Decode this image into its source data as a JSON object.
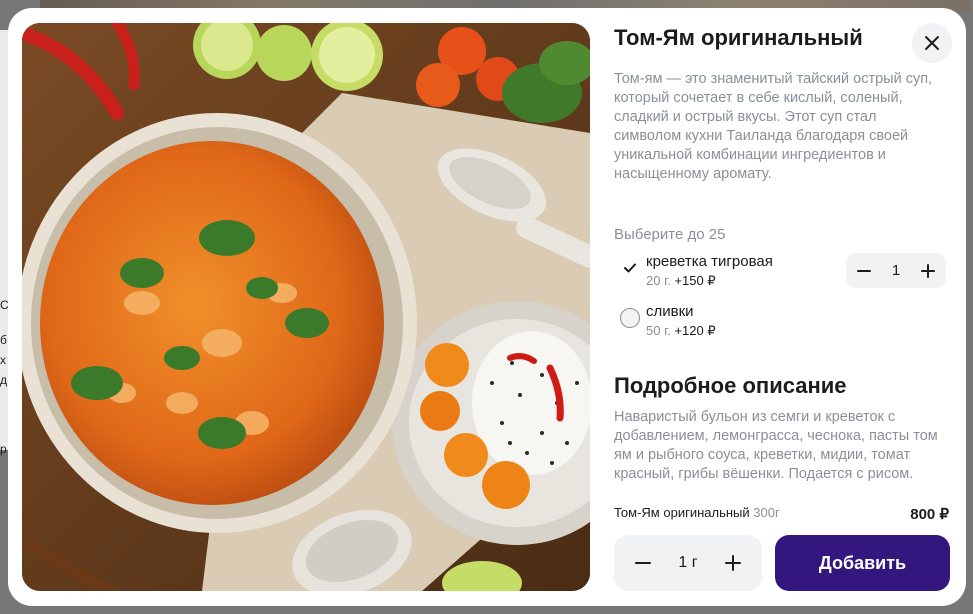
{
  "modal": {
    "title": "Том-Ям оригинальный",
    "close_icon": "close-icon",
    "description": "Том-ям — это знаменитый тайский острый суп, который сочетает в себе кислый, соленый, сладкий и острый вкусы. Этот суп стал символом кухни Таиланда благодаря своей уникальной комбинации ингредиентов и насыщенному аромату.",
    "choose_label": "Выберите до 25",
    "options": [
      {
        "name": "креветка тигровая",
        "weight": "20 г.",
        "price": "+150 ₽",
        "selected": true,
        "quantity": "1",
        "minus_icon": "minus-icon",
        "plus_icon": "plus-icon",
        "check_icon": "check-icon"
      },
      {
        "name": "сливки",
        "weight": "50 г.",
        "price": "+120 ₽",
        "selected": false
      }
    ],
    "details_title": "Подробное описание",
    "details_text": "Наваристый бульон из семги и креветок с добавлением, лемонграсса, чеснока, пасты том ям и рыбного соуса, креветки, мидии, томат красный, грибы вёшенки. Подается с рисом.",
    "summary": {
      "name": "Том-Ям оригинальный",
      "weight": "300г",
      "price": "800 ₽"
    },
    "quantity": {
      "value": "1 г",
      "minus_icon": "minus-icon",
      "plus_icon": "plus-icon"
    },
    "add_button": "Добавить"
  },
  "background": {
    "visible_fragments": [
      "С",
      "б",
      "х",
      "д",
      "р"
    ]
  },
  "colors": {
    "accent": "#33177f",
    "muted_text": "#8a8f99",
    "surface": "#f1f2f4"
  }
}
